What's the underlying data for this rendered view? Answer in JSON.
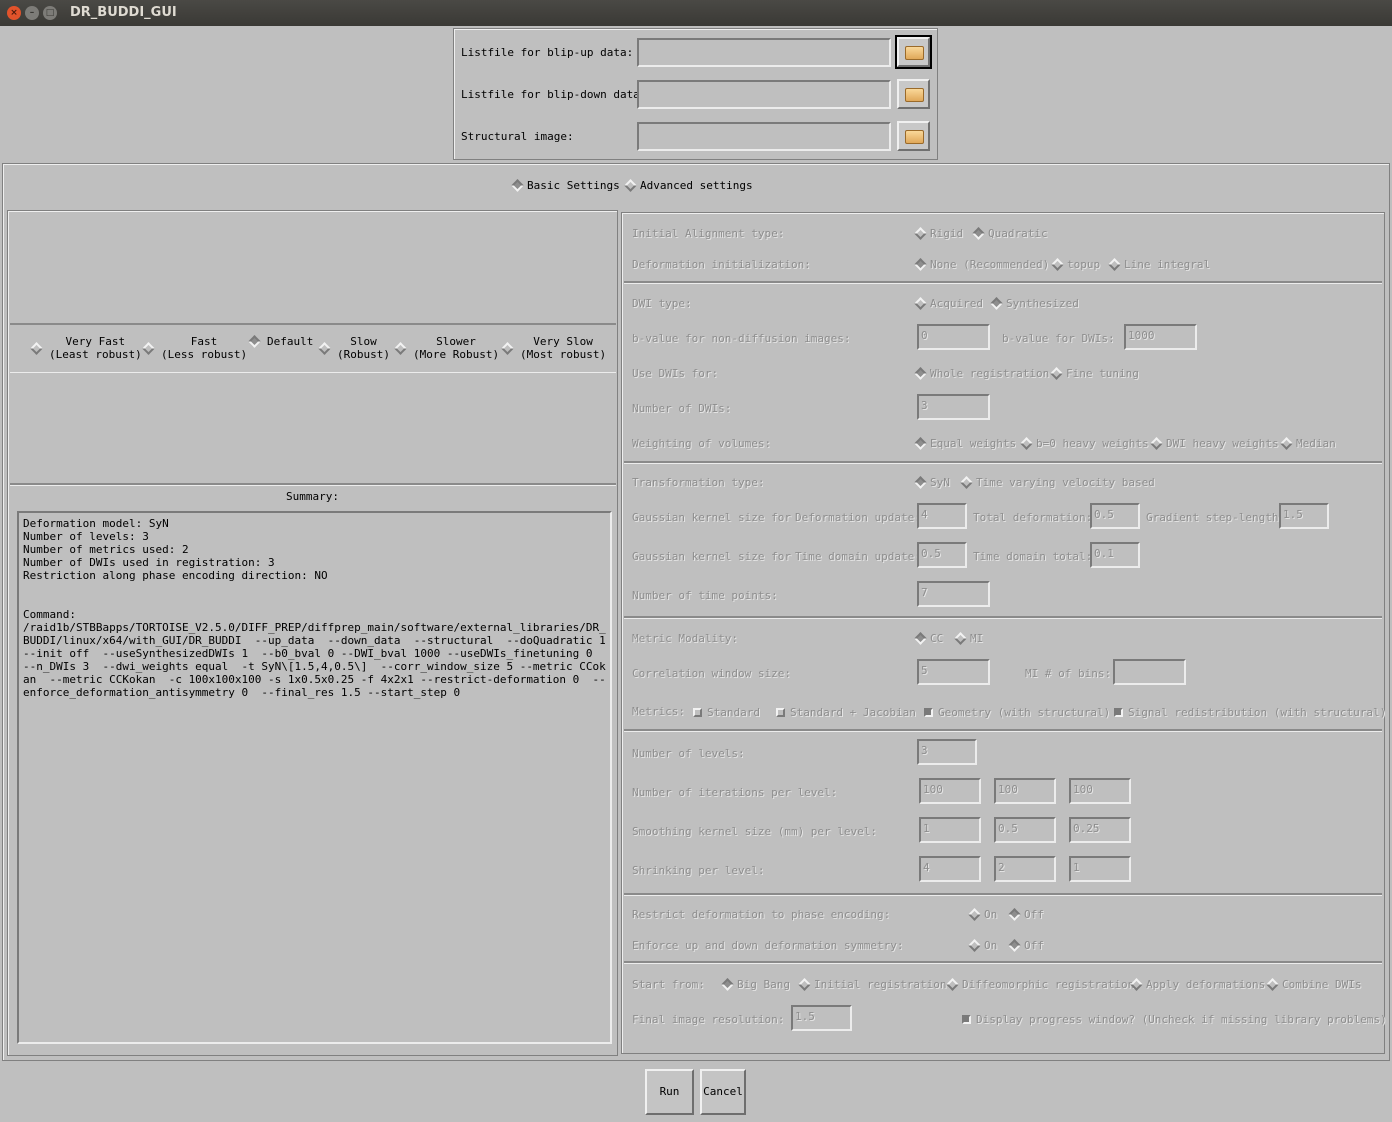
{
  "window": {
    "title": "DR_BUDDI_GUI",
    "close": "×",
    "minimize": "–",
    "maximize": "□"
  },
  "files": [
    {
      "label": "Listfile for blip-up data:",
      "value": "",
      "icon": "folder-icon"
    },
    {
      "label": "Listfile for blip-down data:",
      "value": "",
      "icon": "folder-icon"
    },
    {
      "label": "Structural image:",
      "value": "",
      "icon": "folder-icon"
    }
  ],
  "settings_tabs": [
    {
      "label": "Basic Settings",
      "selected": true
    },
    {
      "label": "Advanced settings",
      "selected": false
    }
  ],
  "speed": [
    {
      "label": "Very Fast\n(Least robust)",
      "selected": false
    },
    {
      "label": "Fast\n(Less robust)",
      "selected": false
    },
    {
      "label": "Default",
      "selected": true
    },
    {
      "label": "Slow\n(Robust)",
      "selected": false
    },
    {
      "label": "Slower\n(More Robust)",
      "selected": false
    },
    {
      "label": "Very Slow\n(Most robust)",
      "selected": false
    }
  ],
  "summary": {
    "label": "Summary:",
    "text": "Deformation model: SyN\nNumber of levels: 3\nNumber of metrics used: 2\nNumber of DWIs used in registration: 3\nRestriction along phase encoding direction: NO\n\n\nCommand:\n/raid1b/STBBapps/TORTOISE_V2.5.0/DIFF_PREP/diffprep_main/software/external_libraries/DR_BUDDI/linux/x64/with_GUI/DR_BUDDI  --up_data  --down_data  --structural  --doQuadratic 1  --init off  --useSynthesizedDWIs 1  --b0_bval 0 --DWI_bval 1000 --useDWIs_finetuning 0  --n_DWIs 3  --dwi_weights equal  -t SyN\\[1.5,4,0.5\\]  --corr_window_size 5 --metric CCokan  --metric CCKokan  -c 100x100x100 -s 1x0.5x0.25 -f 4x2x1 --restrict-deformation 0  --enforce_deformation_antisymmetry 0  --final_res 1.5 --start_step 0"
  },
  "adv": {
    "init_align": {
      "label": "Initial Alignment type:",
      "options": [
        "Rigid",
        "Quadratic"
      ],
      "selected": 1
    },
    "deform_init": {
      "label": "Deformation initialization:",
      "options": [
        "None (Recommended)",
        "topup",
        "Line integral"
      ],
      "selected": 0
    },
    "dwi_type": {
      "label": "DWI type:",
      "options": [
        "Acquired",
        "Synthesized"
      ],
      "selected": 1
    },
    "b0": {
      "label": "b-value for non-diffusion images:",
      "value": "0"
    },
    "bdwi": {
      "label": "b-value for DWIs:",
      "value": "1000"
    },
    "use_dwis": {
      "label": "Use DWIs for:",
      "options": [
        "Whole registration",
        "Fine tuning"
      ],
      "selected": 0
    },
    "n_dwis": {
      "label": "Number of DWIs:",
      "value": "3"
    },
    "weighting": {
      "label": "Weighting of volumes:",
      "options": [
        "Equal weights",
        "b=0 heavy weights",
        "DWI heavy weights",
        "Median"
      ],
      "selected": 0
    },
    "transform": {
      "label": "Transformation type:",
      "options": [
        "SyN",
        "Time varying velocity based"
      ],
      "selected": 0
    },
    "gk1": {
      "label": "Gaussian kernel size for",
      "sub": "Deformation update:",
      "value": "4",
      "total_label": "Total deformation:",
      "total": "0.5",
      "grad_label": "Gradient step-length:",
      "grad": "1.5"
    },
    "gk2": {
      "label": "Gaussian kernel size for",
      "sub": "Time domain update:",
      "value": "0.5",
      "total_label": "Time domain total:",
      "total": "0.1"
    },
    "time_points": {
      "label": "Number of time points:",
      "value": "7"
    },
    "metric_mod": {
      "label": "Metric Modality:",
      "options": [
        "CC",
        "MI"
      ],
      "selected": 0
    },
    "corr": {
      "label": "Correlation window size:",
      "value": "5",
      "mi_label": "MI # of bins:",
      "mi": ""
    },
    "metrics": {
      "label": "Metrics:",
      "options": [
        {
          "label": "Standard",
          "checked": false
        },
        {
          "label": "Standard + Jacobian",
          "checked": false
        },
        {
          "label": "Geometry (with structural)",
          "checked": true
        },
        {
          "label": "Signal redistribution (with structural)",
          "checked": true
        }
      ]
    },
    "levels": {
      "label": "Number of levels:",
      "value": "3"
    },
    "iters": {
      "label": "Number of iterations per level:",
      "values": [
        "100",
        "100",
        "100"
      ]
    },
    "smooth": {
      "label": "Smoothing kernel size (mm) per level:",
      "values": [
        "1",
        "0.5",
        "0.25"
      ]
    },
    "shrink": {
      "label": "Shrinking per level:",
      "values": [
        "4",
        "2",
        "1"
      ]
    },
    "restrict": {
      "label": "Restrict deformation to phase encoding:",
      "options": [
        "On",
        "Off"
      ],
      "selected": 1
    },
    "enforce": {
      "label": "Enforce up and down deformation symmetry:",
      "options": [
        "On",
        "Off"
      ],
      "selected": 1
    },
    "start": {
      "label": "Start from:",
      "options": [
        "Big Bang",
        "Initial registration",
        "Diffeomorphic registration",
        "Apply deformations",
        "Combine DWIs"
      ],
      "selected": 0
    },
    "final_res": {
      "label": "Final image resolution:",
      "value": "1.5"
    },
    "progress": {
      "label": "Display progress window? (Uncheck if missing library problems)",
      "checked": true
    }
  },
  "buttons": {
    "run": "Run",
    "cancel": "Cancel"
  }
}
